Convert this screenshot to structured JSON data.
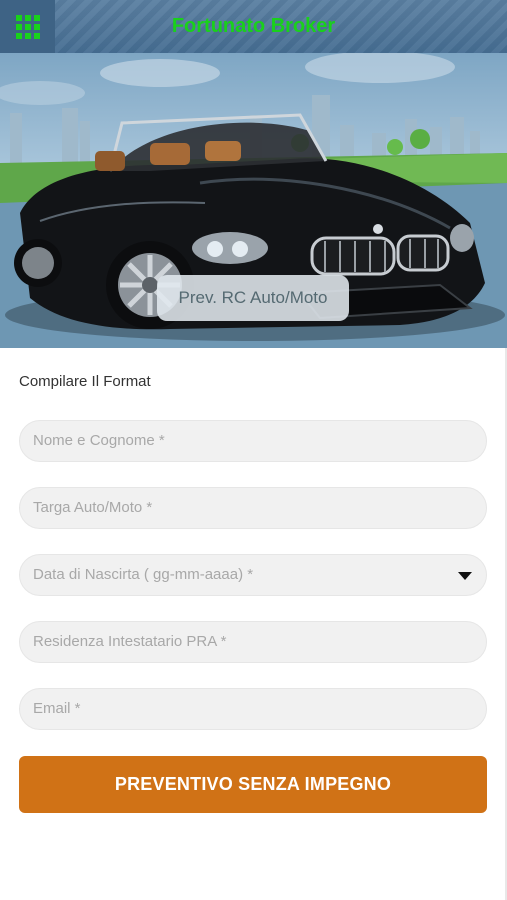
{
  "header": {
    "title": "Fortunato Broker",
    "menu_icon": "grid-menu-icon",
    "title_color": "#19d11b",
    "bar_color": "#4a7397"
  },
  "hero": {
    "image": "black-convertible-car-city-skyline",
    "caption": "Prev. RC Auto/Moto"
  },
  "form": {
    "heading": "Compilare Il Format",
    "fields": [
      {
        "placeholder": "Nome e Cognome *"
      },
      {
        "placeholder": "Targa Auto/Moto *"
      },
      {
        "placeholder": "Data di Nascirta ( gg-mm-aaaa) *",
        "icon": "caret-down-icon"
      },
      {
        "placeholder": "Residenza Intestatario PRA *"
      },
      {
        "placeholder": "Email *"
      }
    ],
    "submit_label": "PREVENTIVO SENZA IMPEGNO",
    "submit_color": "#d07216"
  }
}
